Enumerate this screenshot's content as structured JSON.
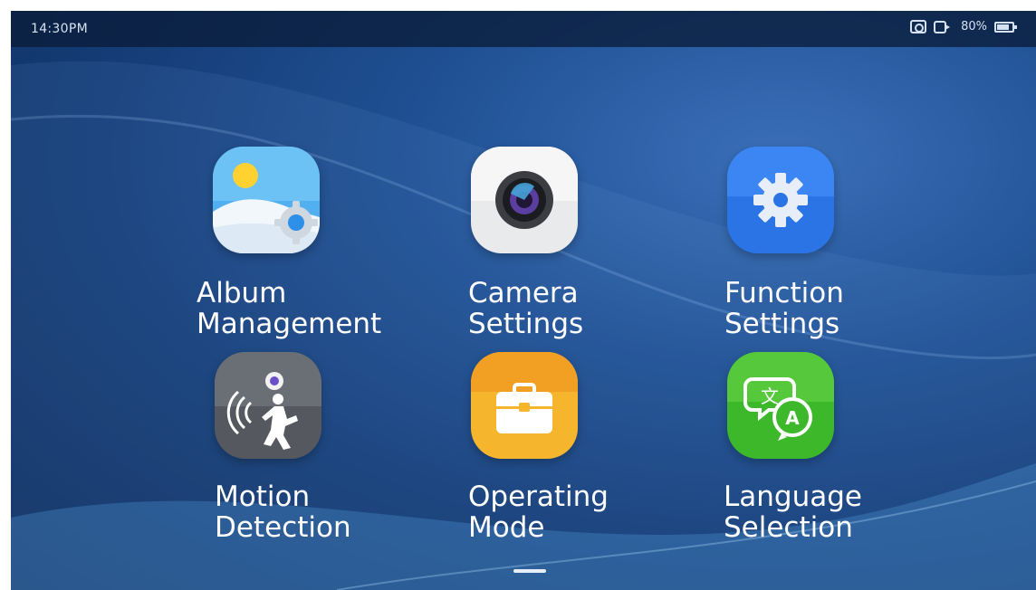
{
  "status_bar": {
    "time": "14:30PM",
    "battery_percent_label": "80%",
    "battery_level": 0.8,
    "icons": [
      "camera-icon",
      "video-camera-icon",
      "battery-icon"
    ]
  },
  "apps": [
    {
      "id": "album",
      "label_line1": "Album",
      "label_line2": "Management",
      "icon": "album-gallery-icon",
      "color": "#4aa8ee"
    },
    {
      "id": "camera",
      "label_line1": "Camera",
      "label_line2": "Settings",
      "icon": "camera-lens-icon",
      "color": "#e8e8e8"
    },
    {
      "id": "function",
      "label_line1": "Function",
      "label_line2": "Settings",
      "icon": "gear-icon",
      "color": "#2f7ff0"
    },
    {
      "id": "motion",
      "label_line1": "Motion",
      "label_line2": "Detection",
      "icon": "motion-sensor-icon",
      "color": "#5a6066"
    },
    {
      "id": "operating",
      "label_line1": "Operating",
      "label_line2": "Mode",
      "icon": "briefcase-icon",
      "color": "#f4b530"
    },
    {
      "id": "language",
      "label_line1": "Language",
      "label_line2": "Selection",
      "icon": "translate-icon",
      "color": "#3cbc2a"
    }
  ]
}
